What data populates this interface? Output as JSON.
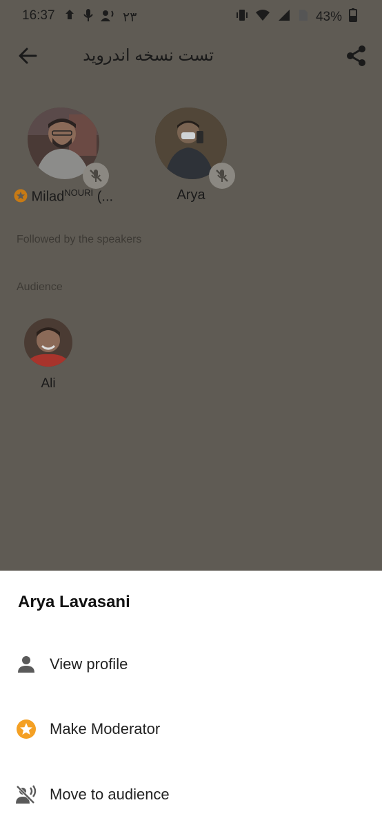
{
  "status_bar": {
    "time": "16:37",
    "extra_text": "۲۳",
    "battery": "43%"
  },
  "header": {
    "title": "تست نسخه اندروید"
  },
  "speakers": [
    {
      "name": "Milad",
      "name_sup": "NOURI",
      "name_suffix": " (...",
      "is_moderator": true,
      "muted": true
    },
    {
      "name": "Arya",
      "is_moderator": false,
      "muted": true
    }
  ],
  "sections": {
    "followed": "Followed by the speakers",
    "audience": "Audience"
  },
  "audience": [
    {
      "name": "Ali"
    }
  ],
  "sheet": {
    "title": "Arya Lavasani",
    "items": [
      {
        "label": "View profile",
        "icon": "person-icon"
      },
      {
        "label": "Make Moderator",
        "icon": "star-badge-icon"
      },
      {
        "label": "Move to audience",
        "icon": "voice-off-icon"
      }
    ]
  },
  "colors": {
    "overlay_background": "#5f5b54",
    "moderator_accent": "#c77a15",
    "sheet_background": "#ffffff"
  }
}
